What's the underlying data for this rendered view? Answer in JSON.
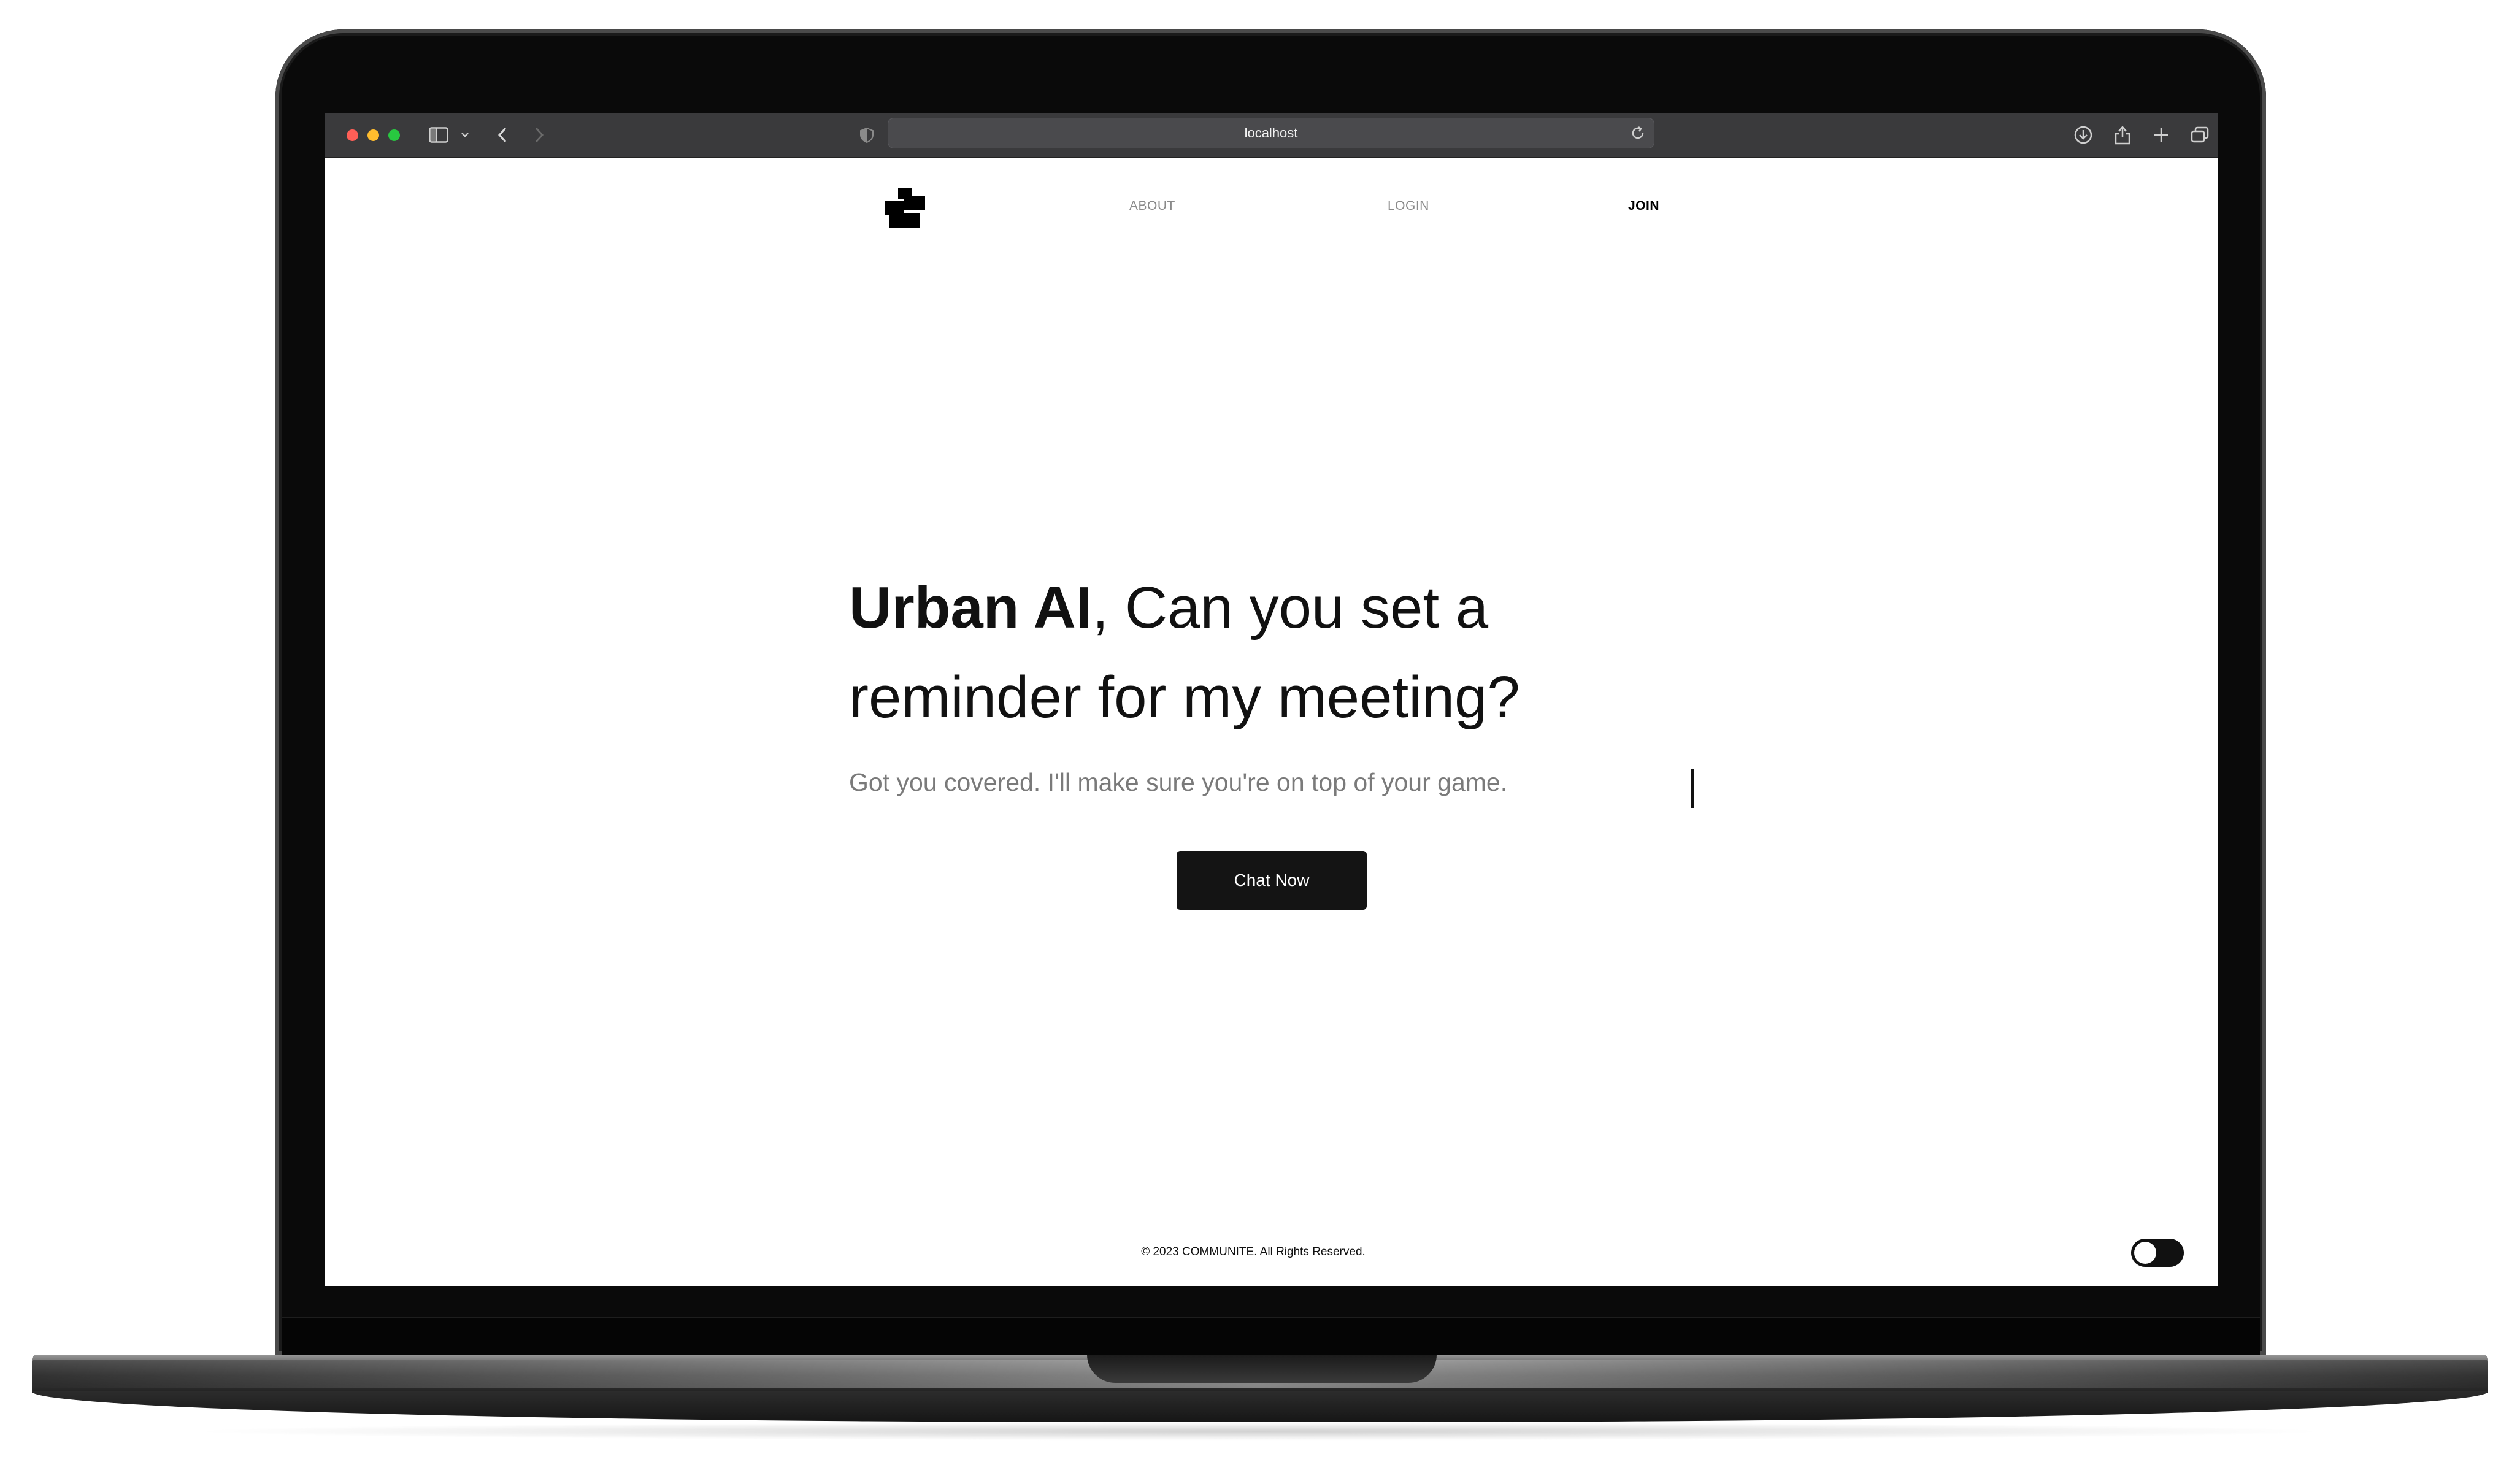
{
  "browser": {
    "url": "localhost"
  },
  "nav": {
    "about": "ABOUT",
    "login": "LOGIN",
    "join": "JOIN"
  },
  "hero": {
    "brand": "Urban AI",
    "title_rest_line1": ", Can you set a",
    "title_line2": "reminder for my meeting?",
    "subtitle": "Got you covered. I'll make sure you're on top of your game.",
    "cta_label": "Chat Now"
  },
  "footer": {
    "copyright": "© 2023 COMMUNITE. All Rights Reserved."
  },
  "theme_toggle": {
    "state": "off"
  },
  "colors": {
    "cta_bg": "#141414",
    "nav_inactive": "#8a8a8a",
    "subtitle": "#7a7a7a",
    "toolbar_bg": "#3a3a3c"
  }
}
